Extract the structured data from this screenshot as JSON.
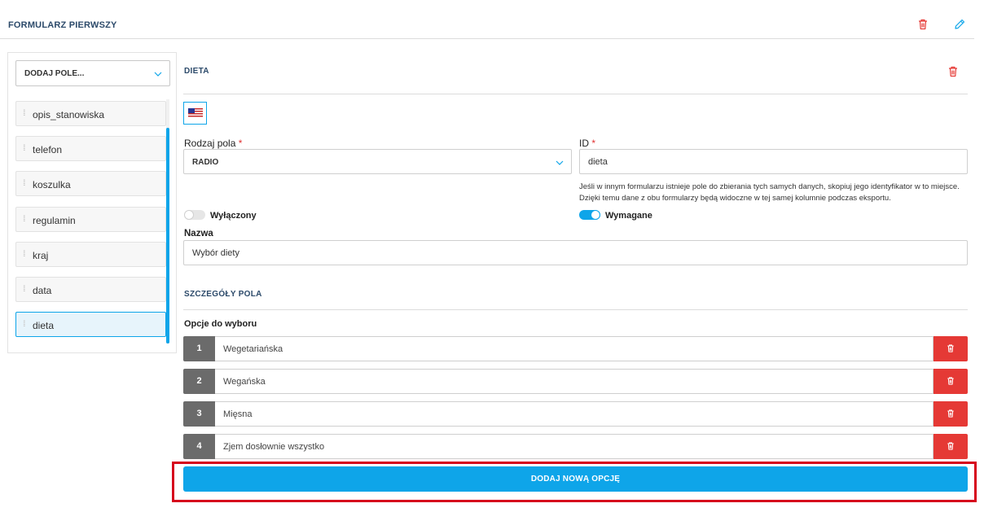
{
  "form": {
    "title": "FORMULARZ PIERWSZY"
  },
  "header_icons": {
    "delete": "trash-icon",
    "edit": "pencil-icon"
  },
  "sidebar": {
    "add_field_label": "DODAJ POLE...",
    "items": [
      {
        "label": "opis_stanowiska"
      },
      {
        "label": "telefon"
      },
      {
        "label": "koszulka"
      },
      {
        "label": "regulamin"
      },
      {
        "label": "kraj"
      },
      {
        "label": "data"
      },
      {
        "label": "dieta",
        "active": true
      }
    ]
  },
  "field": {
    "section_title": "DIETA",
    "language_flag": "us-flag-icon",
    "type_label": "Rodzaj pola",
    "type_value": "RADIO",
    "id_label": "ID",
    "id_value": "dieta",
    "required_mark": "*",
    "hint_line1": "Jeśli w innym formularzu istnieje pole do zbierania tych samych danych, skopiuj jego identyfikator w to miejsce.",
    "hint_line2": "Dzięki temu dane z obu formularzy będą widoczne w tej samej kolumnie podczas eksportu.",
    "disabled_label": "Wyłączony",
    "required_label": "Wymagane",
    "name_label": "Nazwa",
    "name_value": "Wybór diety"
  },
  "details": {
    "section_title": "SZCZEGÓŁY POLA",
    "options_label": "Opcje do wyboru",
    "options": [
      {
        "num": "1",
        "value": "Wegetariańska"
      },
      {
        "num": "2",
        "value": "Wegańska"
      },
      {
        "num": "3",
        "value": "Mięsna"
      },
      {
        "num": "4",
        "value": "Zjem dosłownie wszystko"
      }
    ],
    "add_option_label": "DODAJ NOWĄ OPCJĘ"
  },
  "colors": {
    "accent": "#0ea5e9",
    "danger": "#e53935",
    "highlight": "#d6001c",
    "option_number_bg": "#6b6b6b"
  }
}
